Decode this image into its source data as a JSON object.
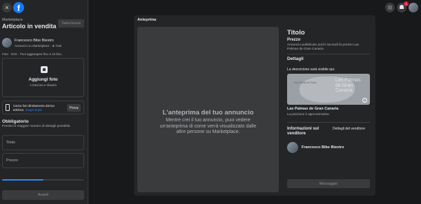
{
  "header": {
    "close_icon": "×",
    "logo_letter": "f",
    "notification_count": "1"
  },
  "left": {
    "breadcrumb": "Marketplace",
    "title": "Articolo in vendita",
    "save_draft": "Salva bozza",
    "user": {
      "name": "Francesco Bibe Biestro",
      "subtitle": "Annuncio su Marketplace · ⊕ Tutti"
    },
    "photo_count": "Foto · 0/10 · Puoi aggiungere fino a 10 foto.",
    "add_photos": "Aggiungi foto",
    "add_photos_sub": "o trascina e rilascia",
    "phone": {
      "text": "Carica foto direttamente dal tuo telefono.",
      "link": "Scopri di più",
      "button": "Prova"
    },
    "required_title": "Obbligatorio",
    "required_sub": "Fornisci il maggior numero di dettagli possibile.",
    "fields": [
      "Titolo",
      "Prezzo"
    ],
    "progress_percent": 50,
    "next_button": "Avanti"
  },
  "preview": {
    "label": "Anteprima",
    "heading": "L'anteprima del tuo annuncio",
    "description": "Mentre crei il tuo annuncio, puoi vedere un'anteprima di come verrà visualizzato dalle altre persone su Marketplace.",
    "listing_title": "Titolo",
    "price": "Prezzo",
    "meta": "Annuncio pubblicato pochi secondi fa presso Las Palmas de Gran Canaria",
    "details_title": "Dettagli",
    "details_desc": "La descrizione sarà visibile qui.",
    "map_label": "Las Palmas de Gran Canaria",
    "map_small_label": "Sta Maria de Guía",
    "location_name": "Las Palmas de Gran Canaria",
    "location_sub": "La posizione è approssimativa",
    "seller_title": "Informazioni sul venditore",
    "seller_link": "Dettagli del venditore",
    "seller_name": "Francesco Bibe Biestro",
    "message_button": "Messaggio"
  },
  "colors": {
    "accent": "#2d88ff",
    "brand": "#1877f2",
    "background": "#18191a",
    "panel": "#242526"
  }
}
